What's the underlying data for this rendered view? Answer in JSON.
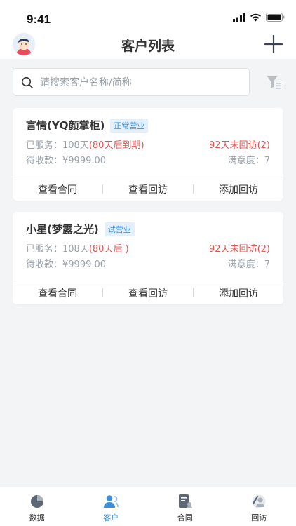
{
  "status_bar": {
    "time": "9:41"
  },
  "header": {
    "title": "客户列表"
  },
  "search": {
    "placeholder": "请搜索客户名称/简称",
    "value": ""
  },
  "customers": [
    {
      "name": "言情(YQ颜掌柜)",
      "status": "正常营业",
      "served_prefix": "已服务：108天",
      "served_note": "(80天后到期)",
      "no_visit": "92天未回访(2)",
      "pending": "待收款：¥9999.00",
      "satisfaction": "满意度：7",
      "actions": [
        "查看合同",
        "查看回访",
        "添加回访"
      ]
    },
    {
      "name": "小星(梦露之光)",
      "status": "试营业",
      "served_prefix": "已服务：108天",
      "served_note": "(80天后 )",
      "no_visit": "92天未回访(2)",
      "pending": "待收款：¥9999.00",
      "satisfaction": "满意度：7",
      "actions": [
        "查看合同",
        "查看回访",
        "添加回访"
      ]
    }
  ],
  "tabs": [
    {
      "label": "数据",
      "icon": "pie-chart-icon",
      "active": false
    },
    {
      "label": "客户",
      "icon": "user-icon",
      "active": true
    },
    {
      "label": "合同",
      "icon": "contract-icon",
      "active": false
    },
    {
      "label": "回访",
      "icon": "visit-icon",
      "active": false
    }
  ],
  "colors": {
    "accent": "#3b8fd6",
    "warning": "#e25454",
    "muted": "#9aa1a9"
  }
}
